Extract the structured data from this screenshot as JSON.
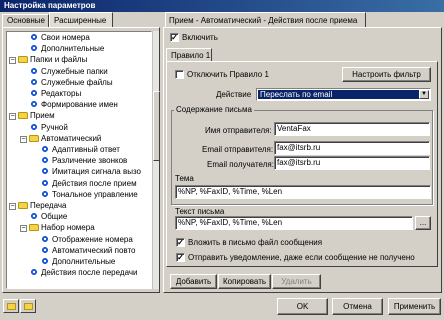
{
  "window": {
    "title": "Настройка параметров"
  },
  "left_tabs": [
    "Основные",
    "Расширенные"
  ],
  "tree": {
    "items": [
      {
        "label": "Свои номера",
        "icon": "gear-icon",
        "indent": 2
      },
      {
        "label": "Дополнительные",
        "icon": "gear-icon",
        "indent": 2
      },
      {
        "label": "Папки и файлы",
        "icon": "folder-icon",
        "indent": 0,
        "expander": "−"
      },
      {
        "label": "Служебные папки",
        "icon": "gear-icon",
        "indent": 2
      },
      {
        "label": "Служебные файлы",
        "icon": "gear-icon",
        "indent": 2
      },
      {
        "label": "Редакторы",
        "icon": "gear-icon",
        "indent": 2
      },
      {
        "label": "Формирование имен",
        "icon": "gear-icon",
        "indent": 2
      },
      {
        "label": "Прием",
        "icon": "folder-icon",
        "indent": 0,
        "expander": "−"
      },
      {
        "label": "Ручной",
        "icon": "gear-icon",
        "indent": 2
      },
      {
        "label": "Автоматический",
        "icon": "folder-icon",
        "indent": 1,
        "expander": "−"
      },
      {
        "label": "Адаптивный ответ",
        "icon": "gear-icon",
        "indent": 3
      },
      {
        "label": "Различение звонков",
        "icon": "gear-icon",
        "indent": 3
      },
      {
        "label": "Имитация сигнала вызо",
        "icon": "gear-icon",
        "indent": 3
      },
      {
        "label": "Действия после прием",
        "icon": "gear-icon",
        "indent": 3
      },
      {
        "label": "Тональное управление",
        "icon": "gear-icon",
        "indent": 3
      },
      {
        "label": "Передача",
        "icon": "folder-icon",
        "indent": 0,
        "expander": "−"
      },
      {
        "label": "Общие",
        "icon": "gear-icon",
        "indent": 2
      },
      {
        "label": "Набор номера",
        "icon": "folder-icon",
        "indent": 1,
        "expander": "−"
      },
      {
        "label": "Отображение номера",
        "icon": "gear-icon",
        "indent": 3
      },
      {
        "label": "Автоматический повто",
        "icon": "gear-icon",
        "indent": 3
      },
      {
        "label": "Дополнительные",
        "icon": "gear-icon",
        "indent": 3
      },
      {
        "label": "Действия после передачи",
        "icon": "gear-icon",
        "indent": 2
      }
    ]
  },
  "panel": {
    "title": "Прием - Автоматический - Действия после приема",
    "enable_label": "Включить",
    "enable_checked": true,
    "rule_tab": "Правило 1",
    "disable_rule_label": "Отключить Правило 1",
    "disable_rule_checked": false,
    "configure_filter_button": "Настроить фильтр",
    "action_label": "Действие",
    "action_value": "Переслать по email",
    "content_group_title": "Содержание письма",
    "sender_name_label": "Имя отправителя:",
    "sender_name_value": "VentaFax",
    "sender_email_label": "Email отправителя:",
    "sender_email_value": "fax@itsrb.ru",
    "recipient_email_label": "Email получателя:",
    "recipient_email_value": "fax@itsrb.ru",
    "subject_label": "Тема",
    "subject_value": "%NP, %FaxID, %Time, %Len",
    "body_label": "Текст письма",
    "body_value": "%NP, %FaxID, %Time, %Len",
    "browse_button": "...",
    "attach_label": "Вложить в письмо файл сообщения",
    "attach_checked": true,
    "notify_label": "Отправить уведомление, даже если сообщение не получено",
    "notify_checked": true,
    "add_button": "Добавить",
    "copy_button": "Копировать",
    "delete_button": "Удалить"
  },
  "footer": {
    "ok_button": "OK",
    "cancel_button": "Отмена",
    "apply_button": "Применить"
  }
}
